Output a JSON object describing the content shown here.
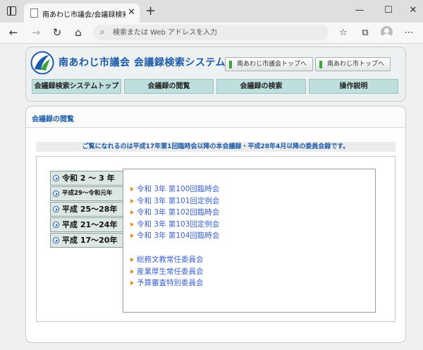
{
  "browser": {
    "tab_title": "南あわじ市議会/会議録検索システム",
    "address_placeholder": "検索または Web アドレスを入力"
  },
  "site": {
    "title": "南あわじ市議会 会議録検索システム",
    "top_links": [
      "南あわじ市議会トップへ",
      "南あわじ市トップへ"
    ],
    "nav": [
      "会議録検索システムトップ",
      "会議録の閲覧",
      "会議録の検索",
      "操作説明"
    ]
  },
  "content": {
    "section_title": "会議録の閲覧",
    "notice": "ご覧になれるのは平成17年第1回臨時会以降の本会議録・平成28年4月以降の委員会録です。",
    "eras": [
      "令和 2 ～ 3 年",
      "平成29～令和元年",
      "平成 25～28年",
      "平成 21～24年",
      "平成 17～20年"
    ],
    "sessions": [
      "令和 3年 第100回臨時会",
      "令和 3年 第101回定例会",
      "令和 3年 第102回臨時会",
      "令和 3年 第103回定例会",
      "令和 3年 第104回臨時会"
    ],
    "committees": [
      "総務文教常任委員会",
      "産業厚生常任委員会",
      "予算審査特別委員会"
    ]
  },
  "colors": {
    "brand_blue": "#1b5aa9",
    "link_blue": "#3a5fcd",
    "nav_teal": "#bfdede",
    "bullet_orange": "#e98a1f"
  },
  "icons": [
    "window-icon",
    "page-favicon",
    "close-icon",
    "plus-icon",
    "minimize-icon",
    "maximize-icon",
    "back-arrow-icon",
    "forward-arrow-icon",
    "refresh-icon",
    "home-icon",
    "search-icon",
    "favorites-icon",
    "collections-icon",
    "profile-icon",
    "more-icon",
    "logo-icon",
    "arrow-circle-icon",
    "triangle-bullet-icon"
  ]
}
